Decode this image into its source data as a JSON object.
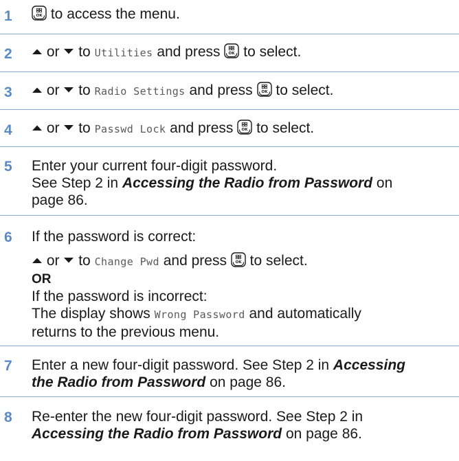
{
  "icons": {
    "ok_button": "menu-ok-button-icon",
    "up": "up-arrow-icon",
    "down": "down-arrow-icon"
  },
  "colors": {
    "step_number": "#5b8ac6",
    "divider": "#8aa9cf",
    "menu_text": "#5a5a5a"
  },
  "common": {
    "or": "or",
    "to": "to",
    "and_press": "and press",
    "to_select": "to select."
  },
  "steps": [
    {
      "num": "1",
      "text": "to access the menu."
    },
    {
      "num": "2",
      "menu": "Utilities"
    },
    {
      "num": "3",
      "menu": "Radio Settings"
    },
    {
      "num": "4",
      "menu": "Passwd Lock"
    },
    {
      "num": "5",
      "line1": "Enter your current four-digit password.",
      "line2_pre": "See Step 2 in",
      "line2_ref": "Accessing the Radio from Password",
      "line2_post": "on",
      "line3": "page 86."
    },
    {
      "num": "6",
      "line1": "If the password is correct:",
      "menu": "Change Pwd",
      "or_label": "OR",
      "line3": "If the password is incorrect:",
      "line4_pre": "The display shows",
      "line4_menu": "Wrong Password",
      "line4_post": "and automatically",
      "line5": "returns to the previous menu."
    },
    {
      "num": "7",
      "line1_pre": "Enter a new four-digit password. See Step 2 in",
      "line1_ref": "Accessing",
      "line2_ref": "the Radio from Password",
      "line2_post": "on page 86."
    },
    {
      "num": "8",
      "line1": "Re-enter the new four-digit password.  See Step 2 in",
      "line2_ref": "Accessing the Radio from Password",
      "line2_post": "on page 86."
    }
  ]
}
